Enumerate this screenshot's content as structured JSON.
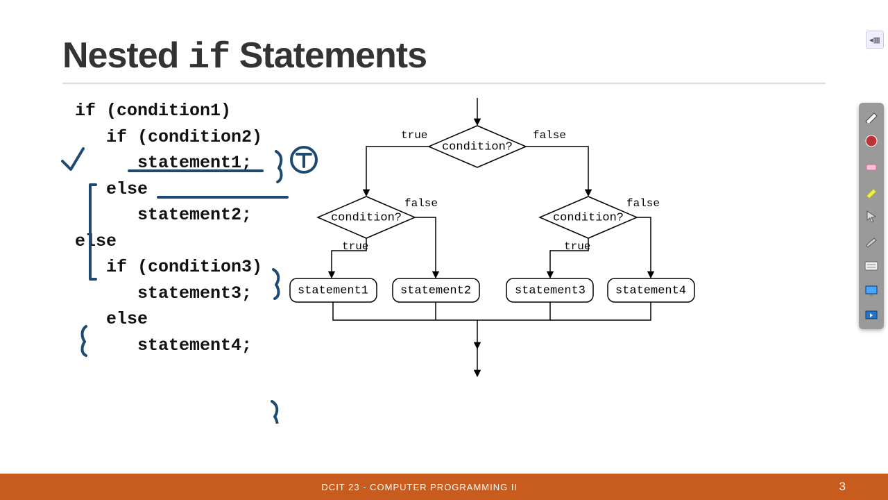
{
  "title": {
    "pre": "Nested ",
    "mono": "if",
    "post": " Statements"
  },
  "code_lines": [
    "if (condition1)",
    "   if (condition2)",
    "      statement1;",
    "   else",
    "      statement2;",
    "else",
    "   if (condition3)",
    "      statement3;",
    "   else",
    "      statement4;"
  ],
  "flow": {
    "top_cond": "condition?",
    "left_cond": "condition?",
    "right_cond": "condition?",
    "s1": "statement1",
    "s2": "statement2",
    "s3": "statement3",
    "s4": "statement4",
    "t": "true",
    "f": "false"
  },
  "footer": {
    "course": "DCIT 23 - COMPUTER PROGRAMMING II",
    "page": "3"
  },
  "annotation_color": "#1e4a72",
  "tools": [
    "pen-icon",
    "laser-icon",
    "eraser-icon",
    "highlighter-icon",
    "pointer-icon",
    "brush-icon",
    "keyboard-icon",
    "screen-icon",
    "switch-icon"
  ]
}
